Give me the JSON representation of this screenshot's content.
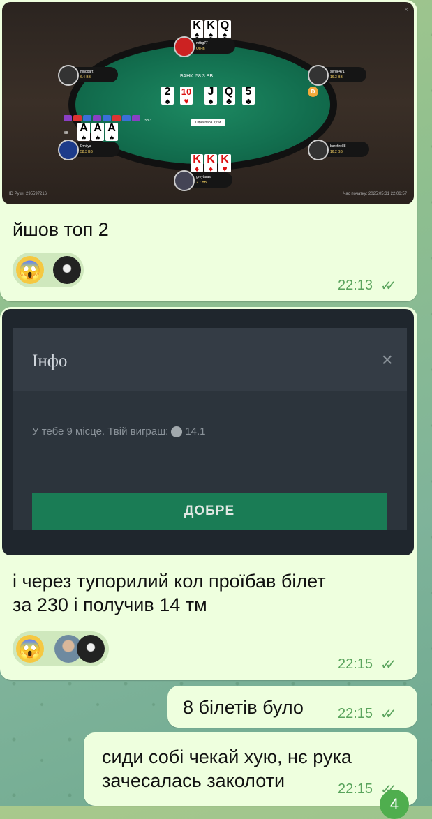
{
  "messages": [
    {
      "text": "йшов топ 2",
      "time": "22:13",
      "reactions": [
        "😱"
      ],
      "poker": {
        "pot_label": "БАНК: 58.3 BB",
        "combo_label": "Одна пара Тузи",
        "hand_id": "ID Руки: 295597216",
        "start_time": "Час початку: 2025:05:31 22:06:57",
        "dealer": "D",
        "top_seat": {
          "name": "mtbg77",
          "stack": "Ou-In"
        },
        "left_top_seat": {
          "name": "mhdgart",
          "stack": "6.4 BB"
        },
        "right_top_seat": {
          "name": "serge471",
          "stack": "16.3 BB"
        },
        "left_bottom_seat": {
          "name": "Dmitya",
          "stack": "58.3 BB"
        },
        "right_bottom_seat": {
          "name": "barefire88",
          "stack": "16.2 BB"
        },
        "bottom_seat": {
          "name": "greytaras",
          "stack": "2.7 BB"
        },
        "side_stack": "58.3 BB",
        "top_cards": [
          {
            "rank": "K",
            "suit": "♠",
            "red": false
          },
          {
            "rank": "K",
            "suit": "♠",
            "red": false
          },
          {
            "rank": "Q",
            "suit": "♠",
            "red": false
          }
        ],
        "board": [
          {
            "rank": "2",
            "suit": "♠",
            "red": false
          },
          {
            "rank": "10",
            "suit": "♥",
            "red": true
          },
          {
            "rank": "J",
            "suit": "♠",
            "red": false
          },
          {
            "rank": "Q",
            "suit": "♣",
            "red": false
          },
          {
            "rank": "5",
            "suit": "♣",
            "red": false
          }
        ],
        "hero_cards": [
          {
            "rank": "A",
            "suit": "♠",
            "red": false
          },
          {
            "rank": "A",
            "suit": "♠",
            "red": false
          },
          {
            "rank": "A",
            "suit": "♠",
            "red": false
          }
        ],
        "bottom_cards": [
          {
            "rank": "K",
            "suit": "♦",
            "red": true
          },
          {
            "rank": "K",
            "suit": "♦",
            "red": true
          },
          {
            "rank": "K",
            "suit": "♥",
            "red": true
          }
        ]
      }
    },
    {
      "text_lines": [
        "і через тупорилий кол проїбав білет",
        "за 230  і получив 14 тм"
      ],
      "time": "22:15",
      "reactions": [
        "😱"
      ],
      "dialog": {
        "title": "Інфо",
        "close": "×",
        "body_prefix": "У тебе 9 місце. Твій виграш:",
        "body_value": "14.1",
        "button": "ДОБРЕ"
      }
    },
    {
      "text": "8 білетів було",
      "time": "22:15"
    },
    {
      "text_lines": [
        "сиди собі чекай хую, нє рука",
        "зачесалась заколоти"
      ],
      "time": "22:15"
    }
  ],
  "unread_count": "4",
  "colors": {
    "bubble": "#eeffde",
    "time": "#5aa45d",
    "felt": "#137050",
    "button": "#1a7c55"
  }
}
